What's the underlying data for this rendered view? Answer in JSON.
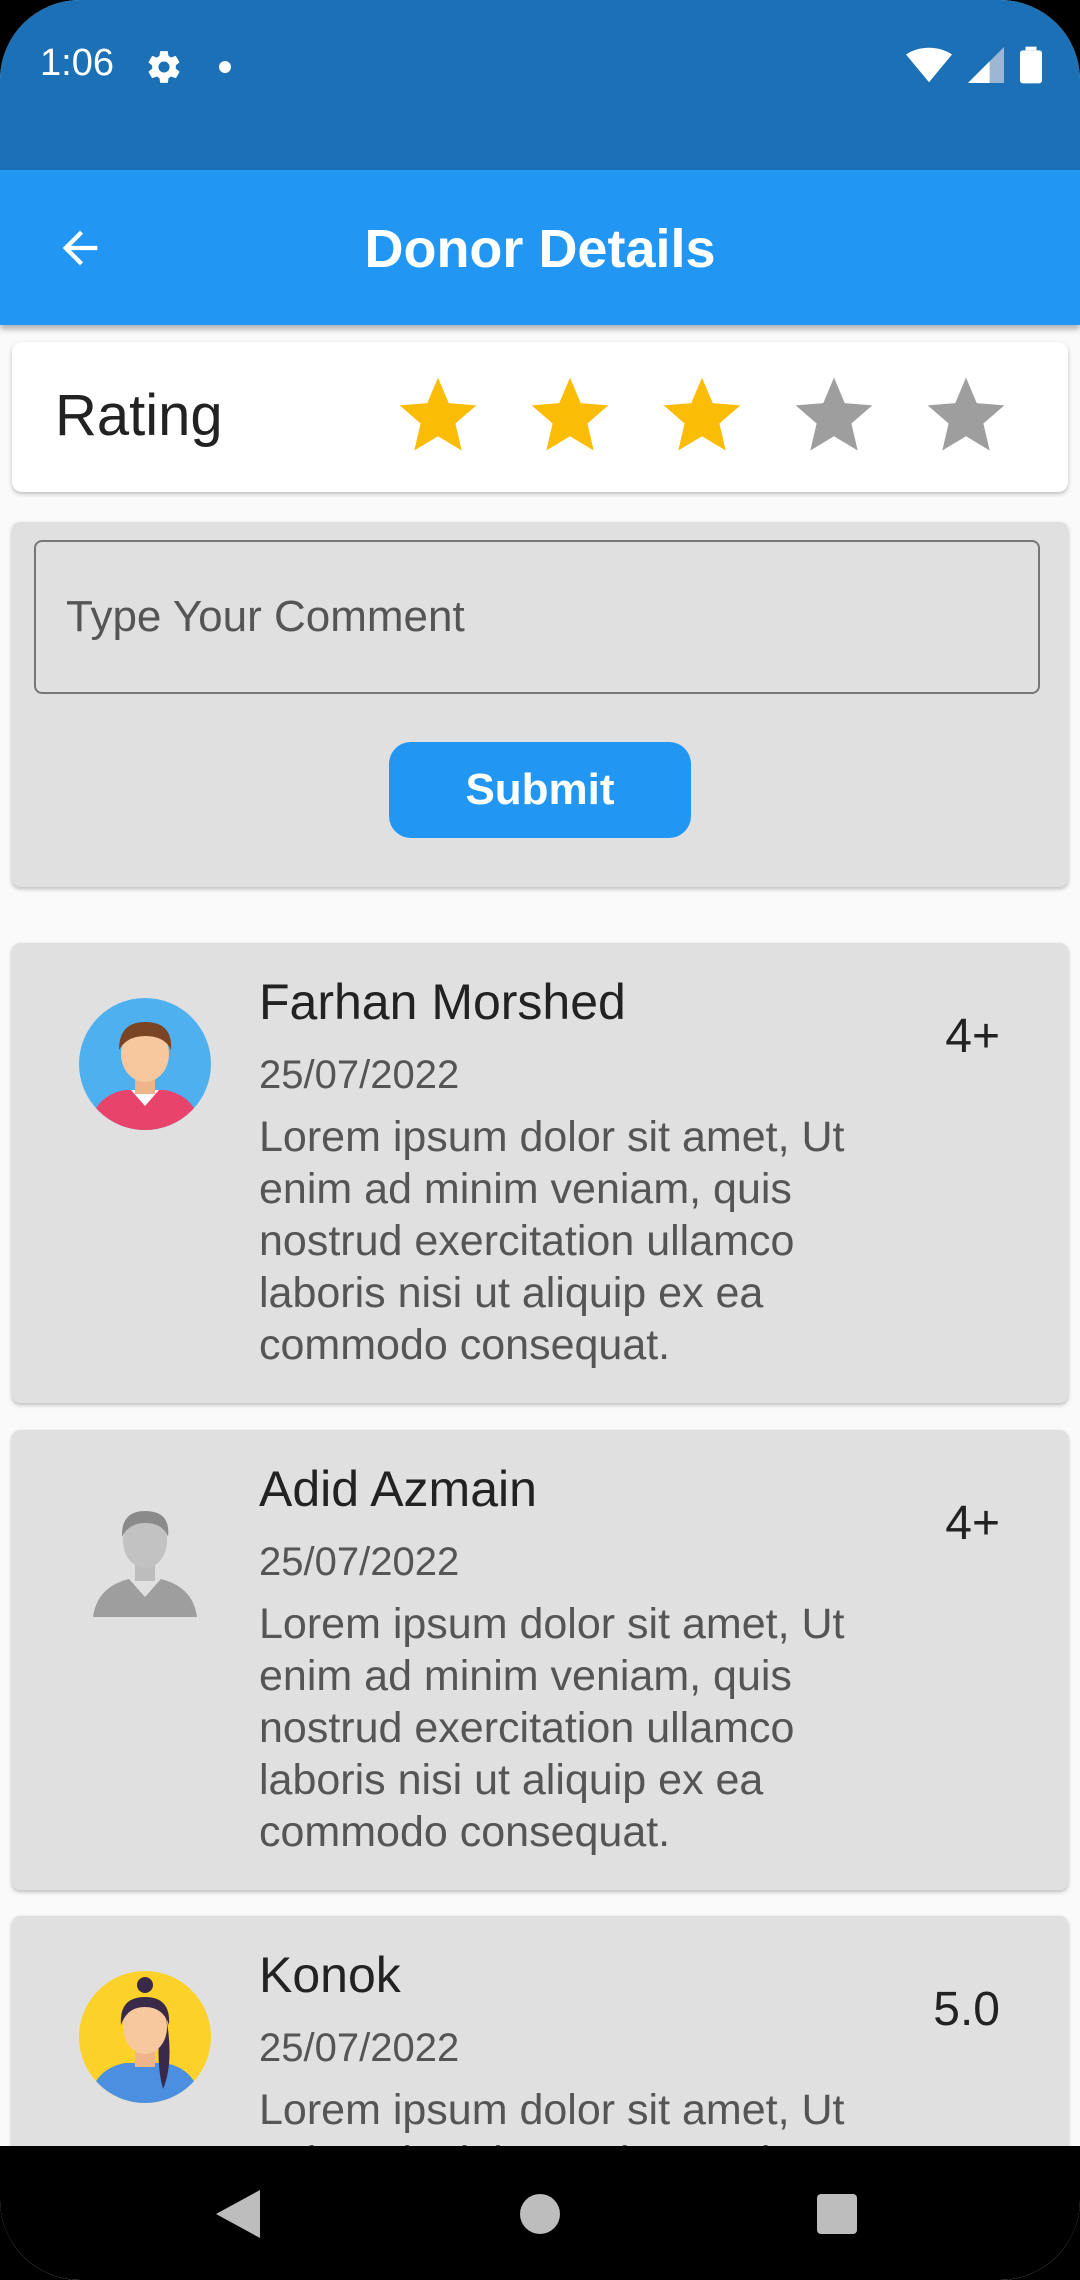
{
  "status_bar": {
    "time": "1:06"
  },
  "app_bar": {
    "title": "Donor Details"
  },
  "rating": {
    "label": "Rating",
    "value": 3,
    "max": 5,
    "filled_color": "#fbbc05",
    "empty_color": "#9e9e9e"
  },
  "comment": {
    "placeholder": "Type Your Comment",
    "submit_label": "Submit"
  },
  "reviews": [
    {
      "name": "Farhan Morshed",
      "date": "25/07/2022",
      "text": "Lorem ipsum dolor sit amet, Ut enim ad minim veniam, quis nostrud exercitation ullamco laboris nisi ut aliquip ex ea commodo consequat.",
      "score": "4+",
      "avatar": "male-avatar-icon"
    },
    {
      "name": "Adid Azmain",
      "date": "25/07/2022",
      "text": "Lorem ipsum dolor sit amet, Ut enim ad minim veniam, quis nostrud exercitation ullamco laboris nisi ut aliquip ex ea commodo consequat.",
      "score": "4+",
      "avatar": "default-user-icon"
    },
    {
      "name": "Konok",
      "date": "25/07/2022",
      "text": "Lorem ipsum dolor sit amet, Ut enim ad minim veniam, quis nostrud exercitation ullamco laboris nisi ut aliquip ex ea commodo consequat.",
      "score": "5.0",
      "avatar": "female-avatar-icon"
    }
  ],
  "colors": {
    "status_bar": "#1b70b6",
    "app_bar": "#2196f3",
    "card": "#e0e0e0"
  }
}
